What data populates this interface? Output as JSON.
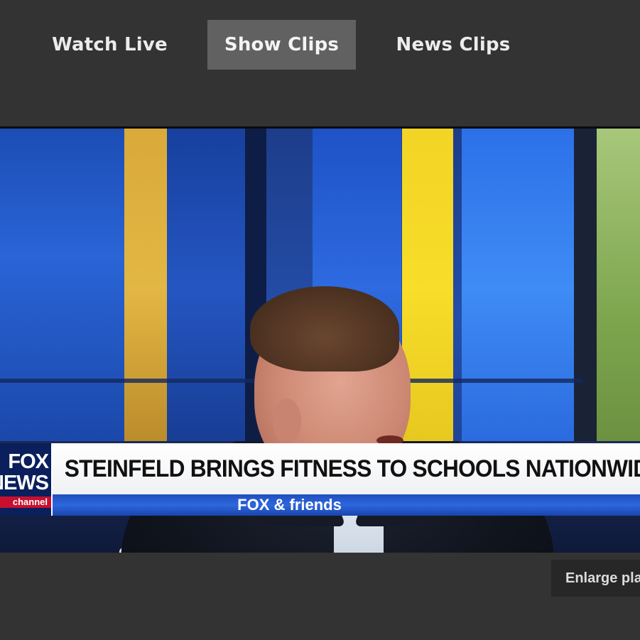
{
  "tabs": [
    {
      "label": "Watch Live",
      "active": false
    },
    {
      "label": "Show Clips",
      "active": true
    },
    {
      "label": "News Clips",
      "active": false
    }
  ],
  "video": {
    "headline": "STEINFELD BRINGS FITNESS TO SCHOOLS NATIONWIDE",
    "network_logo": {
      "line1": "FOX",
      "line2": "NEWS",
      "line3": "channel"
    },
    "show_name": "FOX & friends"
  },
  "controls": {
    "enlarge_label": "Enlarge pla"
  },
  "colors": {
    "page_background": "#333333",
    "active_tab": "#616161",
    "lower_third_blue": "#2e66dd",
    "fox_red": "#c8102e"
  }
}
